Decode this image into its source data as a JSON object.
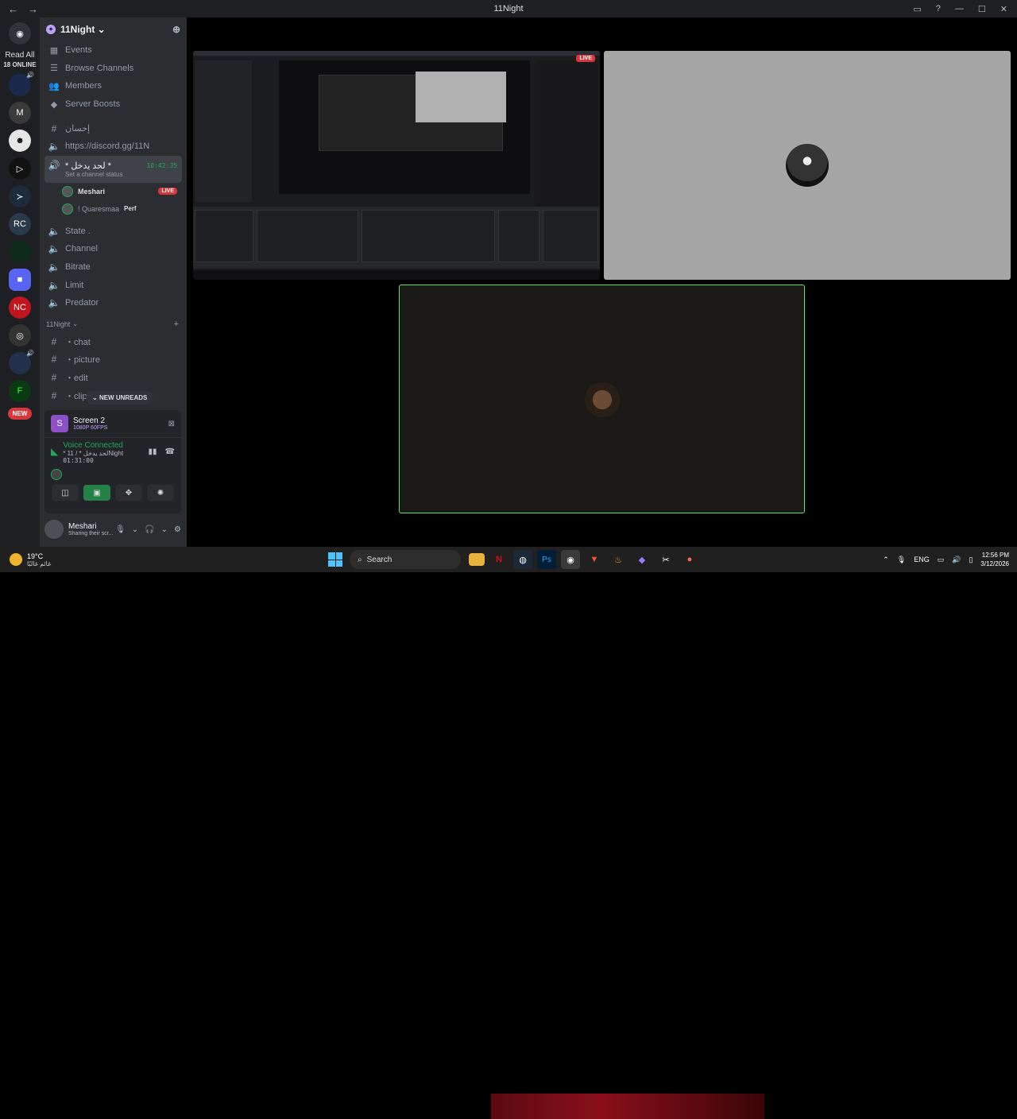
{
  "window": {
    "title": "11Night",
    "back_glyph": "←",
    "forward_glyph": "→",
    "inbox_icon": "inbox-icon",
    "help_icon": "help-icon",
    "minimize": "—",
    "maximize": "☐",
    "close": "✕"
  },
  "guilds": {
    "read_all": "Read All",
    "online": "18 ONLINE",
    "new_badge": "NEW"
  },
  "server": {
    "name": "11Night",
    "nav": [
      {
        "label": "Events",
        "icon": "calendar-icon"
      },
      {
        "label": "Browse Channels",
        "icon": "browse-icon"
      },
      {
        "label": "Members",
        "icon": "members-icon"
      },
      {
        "label": "Server Boosts",
        "icon": "boost-icon"
      }
    ],
    "channels_top": [
      {
        "label": "إحسان",
        "icon": "#"
      },
      {
        "label": "https://discord.gg/11N",
        "icon": "#"
      }
    ],
    "active_voice": {
      "label": "* لحد يدخل *",
      "timer": "10:42:35",
      "status": "Set a channel status",
      "users": [
        {
          "name": "Meshari",
          "live": "LIVE"
        },
        {
          "name": "! Quaresmaa",
          "tag": "Perf"
        }
      ]
    },
    "voice_channels": [
      {
        "label": "State ."
      },
      {
        "label": "Channel"
      },
      {
        "label": "Bitrate"
      },
      {
        "label": "Limit"
      },
      {
        "label": "Predator"
      }
    ],
    "category": "11Night",
    "text_channels": [
      {
        "label": "・chat"
      },
      {
        "label": "・picture"
      },
      {
        "label": "・edit"
      },
      {
        "label": "・clips"
      }
    ],
    "new_unreads": "NEW UNREADS"
  },
  "panel": {
    "screen_title": "Screen 2",
    "screen_sub": "1080P 60FPS",
    "voice_connected": "Voice Connected",
    "voice_channel": "* لحد يدخل * / 11Night",
    "voice_timer": "01:31:00"
  },
  "user": {
    "name": "Meshari",
    "status": "Sharing their scr..."
  },
  "stage": {
    "live_badge": "LIVE"
  },
  "taskbar": {
    "temp": "19°C",
    "weather_text": "غائم غالبًا",
    "search": "Search",
    "lang": "ENG",
    "time": "12:56 PM",
    "date": "3/12/2026",
    "colors": {
      "accent": "#4cc2ff",
      "taskbar": "#202020"
    }
  },
  "colors": {
    "discord_green": "#23a55a",
    "live_red": "#da373c",
    "sidebar": "#2b2d31",
    "guilds": "#1e1f22"
  }
}
